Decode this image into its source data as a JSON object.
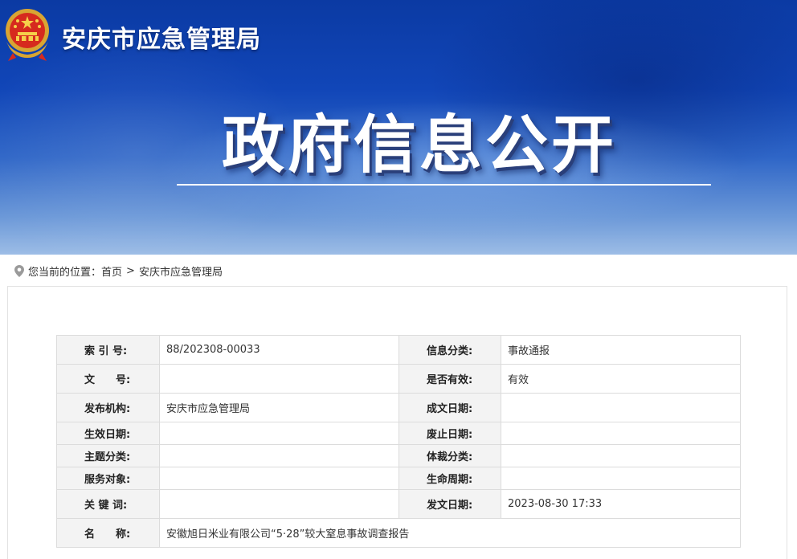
{
  "header": {
    "site_title": "安庆市应急管理局",
    "hero_title": "政府信息公开",
    "emblem_icon": "national-emblem-icon"
  },
  "breadcrumb": {
    "icon": "location-pin-icon",
    "prefix": "您当前的位置：",
    "items": [
      "首页",
      "安庆市应急管理局"
    ],
    "separator": ">"
  },
  "metadata": {
    "rows": [
      {
        "k1": "索 引 号:",
        "v1": "88/202308-00033",
        "k2": "信息分类:",
        "v2": "事故通报"
      },
      {
        "k1": "文　　号:",
        "v1": "",
        "k2": "是否有效:",
        "v2": "有效"
      },
      {
        "k1": "发布机构:",
        "v1": "安庆市应急管理局",
        "k2": "成文日期:",
        "v2": ""
      },
      {
        "k1": "生效日期:",
        "v1": "",
        "k2": "废止日期:",
        "v2": ""
      },
      {
        "k1": "主题分类:",
        "v1": "",
        "k2": "体裁分类:",
        "v2": ""
      },
      {
        "k1": "服务对象:",
        "v1": "",
        "k2": "生命周期:",
        "v2": ""
      },
      {
        "k1": "关 键 词:",
        "v1": "",
        "k2": "发文日期:",
        "v2": "2023-08-30 17:33"
      }
    ],
    "name_label": "名　　称:",
    "name_value": "安徽旭日米业有限公司“5·28”较大窒息事故调查报告"
  },
  "colors": {
    "banner_top": "#0b3aa3",
    "banner_bottom": "#9dbde6",
    "label_cell_bg": "#f3f3f3",
    "border": "#dcdcdc"
  }
}
